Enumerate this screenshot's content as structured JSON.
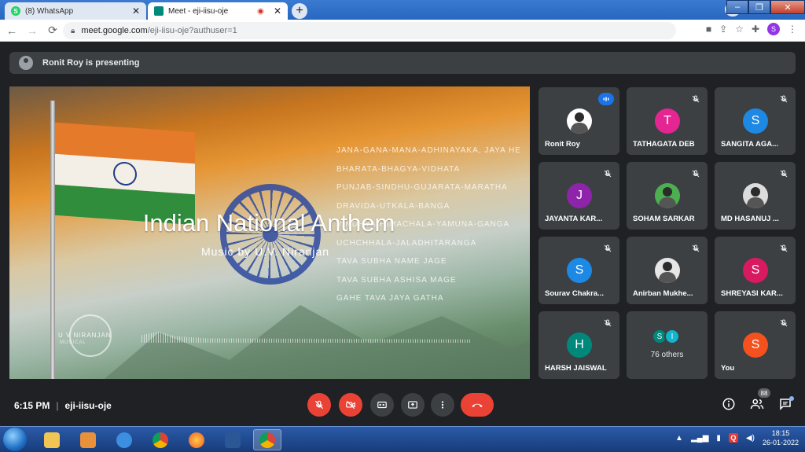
{
  "browser": {
    "tabs": [
      {
        "title": "(8) WhatsApp",
        "close": "✕"
      },
      {
        "title": "Meet - eji-iisu-oje",
        "close": "✕"
      }
    ],
    "new_tab": "+",
    "url_host": "meet.google.com",
    "url_path": "/eji-iisu-oje?authuser=1",
    "profile_initial": "S"
  },
  "meet": {
    "presenting_text": "Ronit Roy is presenting",
    "slide": {
      "title": "Indian National Anthem",
      "subtitle": "Music by U.V. Niranjan",
      "lyrics": [
        "JANA-GANA-MANA-ADHINAYAKA, JAYA HE",
        "BHARATA-BHAGYA-VIDHATA",
        "PUNJAB-SINDHU-GUJARATA-MARATHA",
        "DRAVIDA-UTKALA-BANGA",
        "VINDHYA-HIMACHALA-YAMUNA-GANGA",
        "UCHCHHALA-JALADHITARANGA",
        "TAVA SUBHA NAME JAGE",
        "TAVA SUBHA ASHISA MAGE",
        "GAHE TAVA JAYA GATHA"
      ],
      "logo_name": "U V NIRANJAN",
      "logo_sub": "MUSICAL"
    },
    "participants": [
      {
        "name": "Ronit Roy",
        "initial": "",
        "color": "#ffffff",
        "photo": true,
        "speaking": true
      },
      {
        "name": "TATHAGATA DEB",
        "initial": "T",
        "color": "#e52592",
        "photo": false
      },
      {
        "name": "SANGITA AGA...",
        "initial": "S",
        "color": "#1e88e5",
        "photo": false
      },
      {
        "name": "JAYANTA KAR...",
        "initial": "J",
        "color": "#8e24aa",
        "photo": false
      },
      {
        "name": "SOHAM SARKAR",
        "initial": "",
        "color": "#4caf50",
        "photo": true
      },
      {
        "name": "MD HASANUJ ...",
        "initial": "",
        "color": "#dcdcdc",
        "photo": true
      },
      {
        "name": "Sourav Chakra...",
        "initial": "S",
        "color": "#1e88e5",
        "photo": false
      },
      {
        "name": "Anirban Mukhe...",
        "initial": "",
        "color": "#e6e6e6",
        "photo": true
      },
      {
        "name": "SHREYASI KAR...",
        "initial": "S",
        "color": "#d81b60",
        "photo": false
      },
      {
        "name": "HARSH JAISWAL",
        "initial": "H",
        "color": "#00897b",
        "photo": false
      },
      {
        "name": "76 others",
        "initial": "",
        "color": "",
        "others": [
          "S",
          "I"
        ]
      },
      {
        "name": "You",
        "initial": "S",
        "color": "#f4511e",
        "photo": false
      }
    ],
    "time": "6:15 PM",
    "separator": "|",
    "meeting_code": "eji-iisu-oje",
    "people_count": "88"
  },
  "taskbar": {
    "time": "18:15",
    "date": "26-01-2022",
    "tray_q": "Q"
  }
}
